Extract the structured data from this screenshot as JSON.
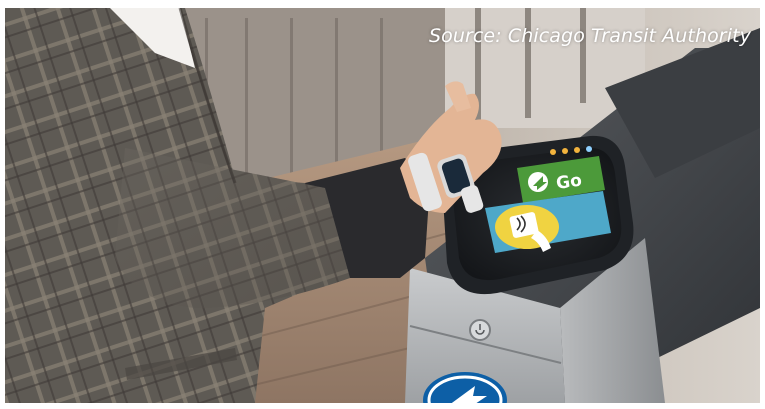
{
  "photo": {
    "caption": "Source: Chicago Transit Authority",
    "reader_display": {
      "status_label": "Go",
      "status_color": "#4c9a3a",
      "tap_panel_color": "#4ea8c9",
      "tap_icon": "contactless-tap-icon"
    },
    "device": "smartwatch-icon",
    "gate_logo": "cta-arrow-logo-icon"
  }
}
